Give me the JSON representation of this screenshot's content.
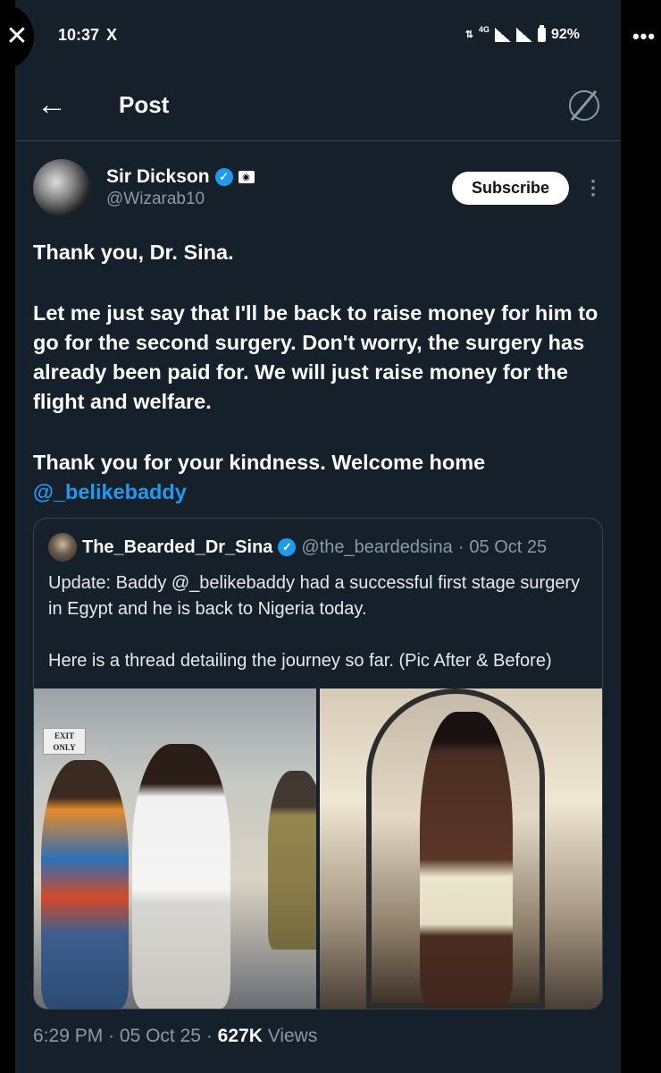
{
  "status_bar": {
    "time": "10:37",
    "x_logo": "X",
    "network": "4G",
    "battery": "92%"
  },
  "overlay": {
    "close": "✕",
    "more": "•••"
  },
  "header": {
    "back_icon": "←",
    "title": "Post"
  },
  "post": {
    "author_name": "Sir Dickson",
    "author_handle": "@Wizarab10",
    "subscribe_label": "Subscribe",
    "more_icon": "⋮",
    "paragraphs": [
      "Thank you, Dr. Sina.",
      "Let me just say that I'll be back to raise money for him to go for the second surgery. Don't worry, the surgery has already been paid for. We will just raise money for the flight and welfare.",
      "Thank you for your kindness. Welcome home"
    ],
    "mention": "@_belikebaddy"
  },
  "quote": {
    "name": "The_Bearded_Dr_Sina",
    "handle": "@the_beardedsina",
    "separator": "·",
    "date": "05 Oct 25",
    "text_prefix": "Update: Baddy ",
    "mention": "@_belikebaddy",
    "text_suffix": " had a successful first stage surgery in Egypt and he is back to Nigeria today.",
    "text_2": "Here is a thread detailing the journey so far. (Pic After & Before)",
    "exit_sign": "EXIT ONLY"
  },
  "meta": {
    "time": "6:29 PM",
    "separator": "·",
    "date": "05 Oct 25",
    "views_count": "627K",
    "views_label": "Views"
  },
  "colors": {
    "background": "#15202b",
    "accent": "#1d9bf0",
    "secondary_text": "#8b98a5"
  }
}
